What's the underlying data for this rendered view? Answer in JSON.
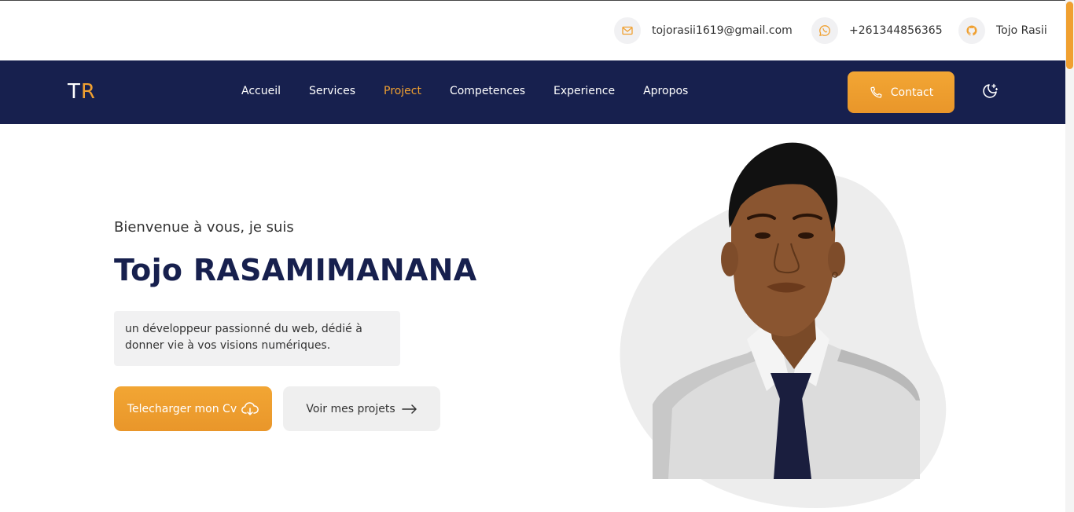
{
  "topbar": {
    "email": "tojorasii1619@gmail.com",
    "phone": "+261344856365",
    "github": "Tojo Rasii",
    "icons": {
      "email": "mail-icon",
      "phone": "whatsapp-icon",
      "github": "github-icon"
    }
  },
  "nav": {
    "logo_t": "T",
    "logo_r": "R",
    "links": [
      "Accueil",
      "Services",
      "Project",
      "Competences",
      "Experience",
      "Apropos"
    ],
    "active": "Project",
    "contact_label": "Contact",
    "theme_icon": "moon-stars-icon"
  },
  "hero": {
    "greeting": "Bienvenue à vous, je suis",
    "name": "Tojo RASAMIMANANA",
    "description": "un développeur passionné du web, dédié à donner vie à vos visions numériques.",
    "cv_button": "Telecharger mon Cv",
    "projects_button": "Voir mes projets"
  },
  "colors": {
    "navy": "#17204e",
    "accent": "#f0a030",
    "light_gray": "#f1f1f2"
  }
}
